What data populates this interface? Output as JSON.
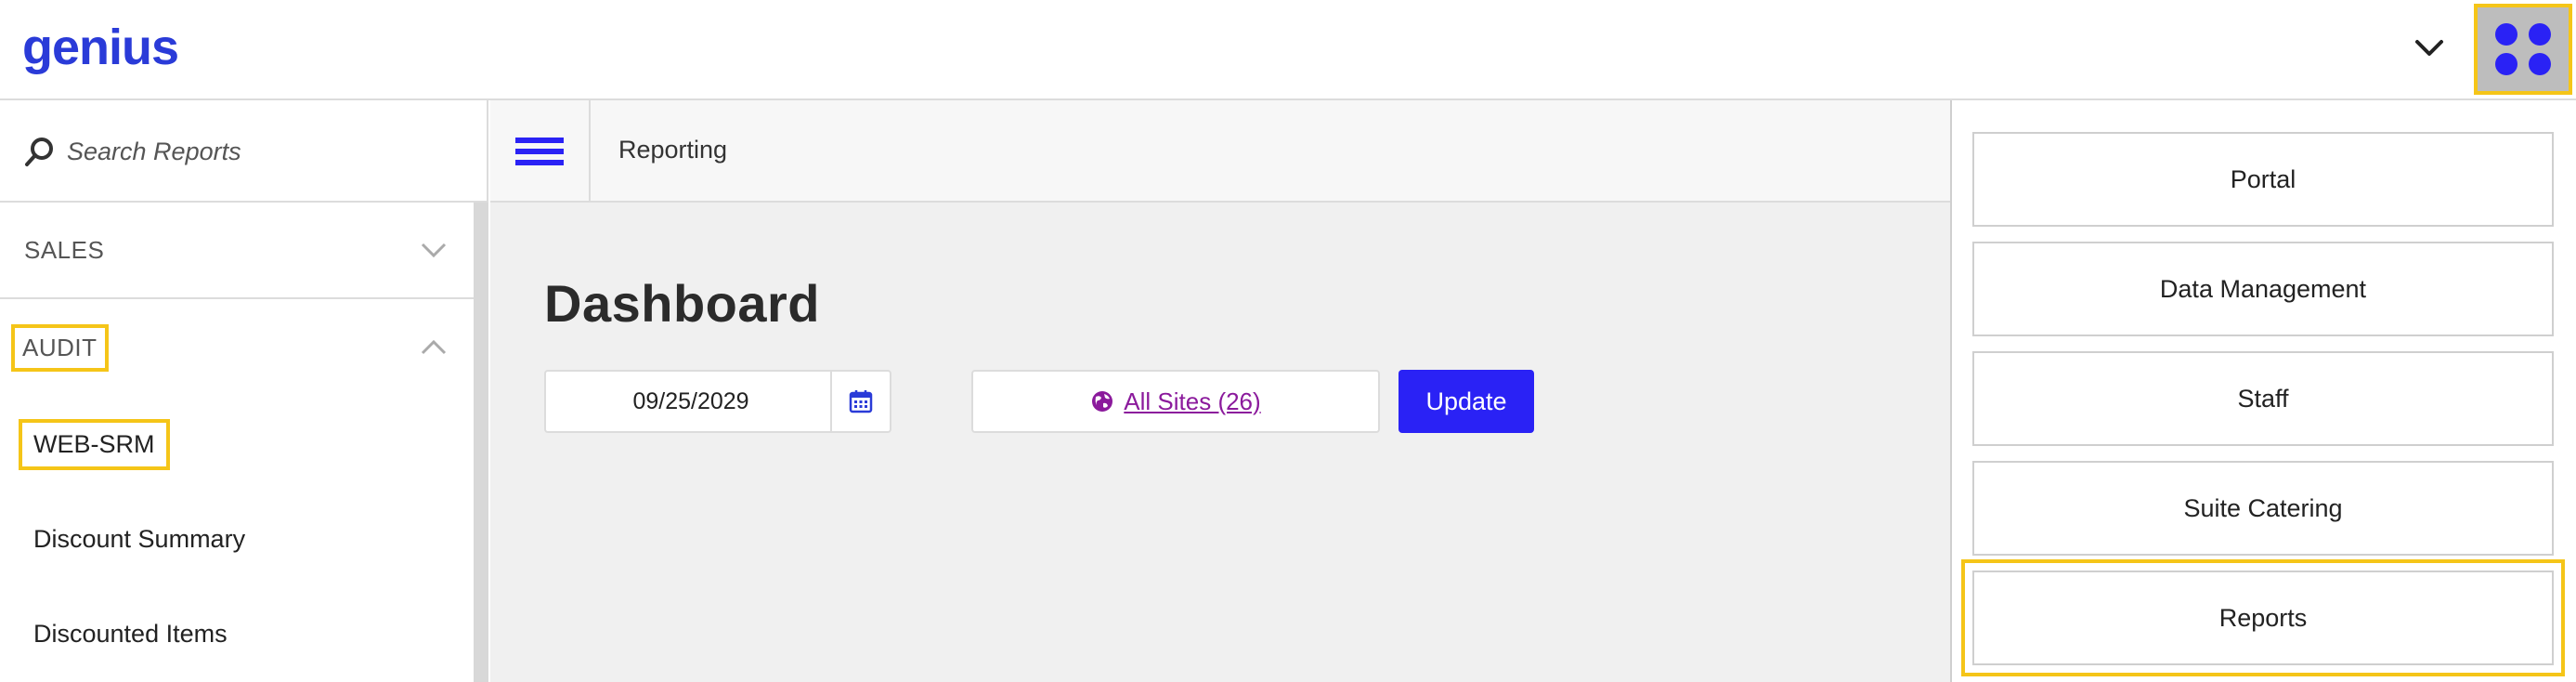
{
  "brand": {
    "logo_text": "genius",
    "accent": "#2a22f5",
    "highlight": "#f5c518"
  },
  "topbar": {
    "chevron_icon": "chevron-down-icon",
    "apps_icon": "apps-grid-icon"
  },
  "sidebar": {
    "search": {
      "placeholder": "Search Reports",
      "value": ""
    },
    "sections": [
      {
        "label": "SALES",
        "expanded": false
      },
      {
        "label": "AUDIT",
        "expanded": true
      }
    ],
    "items": [
      {
        "label": "WEB-SRM"
      },
      {
        "label": "Discount Summary"
      },
      {
        "label": "Discounted Items"
      }
    ]
  },
  "main": {
    "breadcrumb": "Reporting",
    "title": "Dashboard",
    "date": "09/25/2029",
    "sites_label": "All Sites (26)",
    "update_label": "Update"
  },
  "app_menu": {
    "items": [
      {
        "label": "Portal"
      },
      {
        "label": "Data Management"
      },
      {
        "label": "Staff"
      },
      {
        "label": "Suite Catering"
      },
      {
        "label": "Reports"
      }
    ]
  }
}
